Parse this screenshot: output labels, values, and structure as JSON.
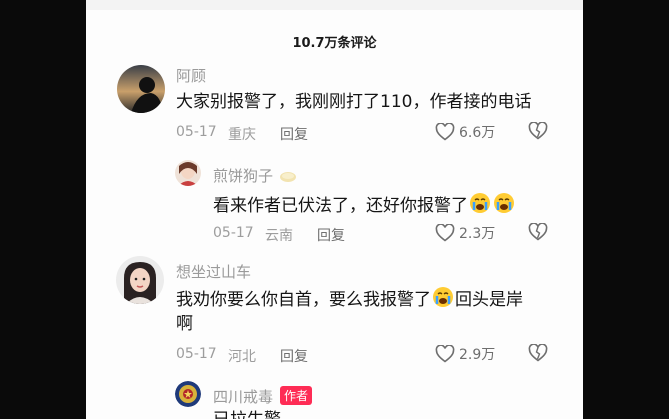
{
  "header": {
    "comment_count": "10.7万条评论"
  },
  "comments": [
    {
      "user": "阿顾",
      "text": "大家别报警了，我刚刚打了110，作者接的电话",
      "date": "05-17",
      "location": "重庆",
      "reply_label": "回复",
      "likes": "6.6万"
    },
    {
      "user": "煎饼狗子",
      "text_before": "看来作者已伏法了，还好你报警了",
      "date": "05-17",
      "location": "云南",
      "reply_label": "回复",
      "likes": "2.3万"
    },
    {
      "user": "想坐过山车",
      "line1_before": "我劝你要么你自首，要么我报警了",
      "line1_after": "回头是岸",
      "line2": "啊",
      "date": "05-17",
      "location": "河北",
      "reply_label": "回复",
      "likes": "2.9万"
    },
    {
      "user": "四川戒毒",
      "badge": "作者",
      "text_partial": "已拉生警"
    }
  ],
  "colors": {
    "badge": "#fe2c55",
    "meta": "#9d9d9d",
    "text": "#151515"
  }
}
